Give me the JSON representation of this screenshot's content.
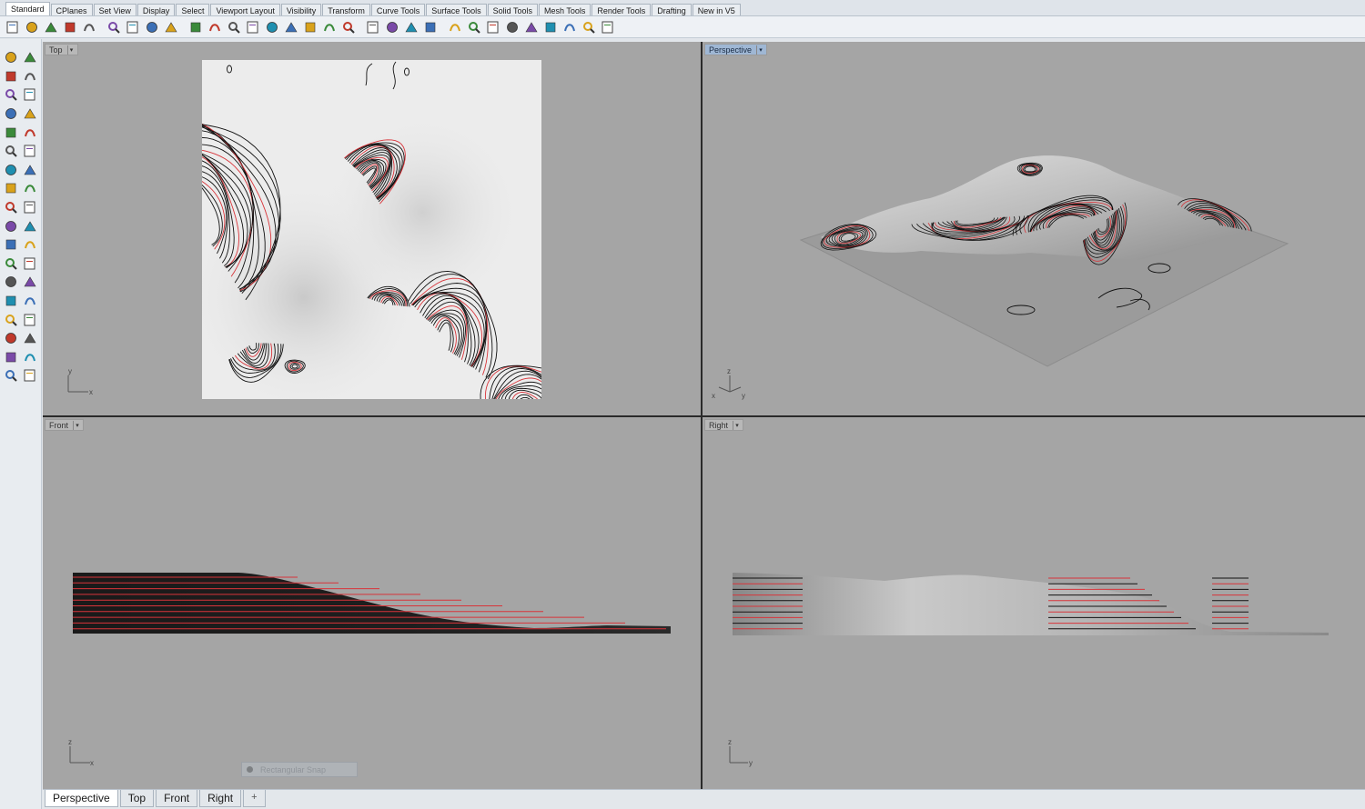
{
  "tabs": [
    {
      "label": "Standard",
      "active": true
    },
    {
      "label": "CPlanes"
    },
    {
      "label": "Set View"
    },
    {
      "label": "Display"
    },
    {
      "label": "Select"
    },
    {
      "label": "Viewport Layout"
    },
    {
      "label": "Visibility"
    },
    {
      "label": "Transform"
    },
    {
      "label": "Curve Tools"
    },
    {
      "label": "Surface Tools"
    },
    {
      "label": "Solid Tools"
    },
    {
      "label": "Mesh Tools"
    },
    {
      "label": "Render Tools"
    },
    {
      "label": "Drafting"
    },
    {
      "label": "New in V5"
    }
  ],
  "toolbar_icons": [
    "new-icon",
    "open-icon",
    "save-icon",
    "print-icon",
    "import-icon",
    "cut-icon",
    "copy-icon",
    "paste-icon",
    "undo-icon",
    "pan-icon",
    "move-view-icon",
    "zoom-icon",
    "zoom-window-icon",
    "zoom-extents-icon",
    "zoom-selected-icon",
    "rotate-view-icon",
    "four-viewports-icon",
    "car-icon",
    "hide-icon",
    "show-icon",
    "light-bulb-icon",
    "lock-icon",
    "shaded-icon",
    "rendered-icon",
    "material-icon",
    "ghosted-icon",
    "render-sphere-icon",
    "pointer-flag-icon",
    "layer-icon",
    "properties-icon",
    "help-icon"
  ],
  "palette_icons": [
    [
      "select-icon",
      "point-icon"
    ],
    [
      "polyline-icon",
      "curve-icon"
    ],
    [
      "circle-icon",
      "ellipse-icon"
    ],
    [
      "polygon-icon",
      "rectangle-icon"
    ],
    [
      "arc-icon",
      "fillet-icon"
    ],
    [
      "surface-icon",
      "loft-icon"
    ],
    [
      "box-icon",
      "sphere-icon"
    ],
    [
      "cylinder-icon",
      "plane-icon"
    ],
    [
      "trim-icon",
      "split-icon"
    ],
    [
      "boolean-icon",
      "explode-icon"
    ],
    [
      "mesh-icon",
      "points-icon"
    ],
    [
      "offset-icon",
      "extend-icon"
    ],
    [
      "text-icon",
      "dimension-icon"
    ],
    [
      "group-icon",
      "block-icon"
    ],
    [
      "solid-edit-icon",
      "measure-icon"
    ],
    [
      "array-icon",
      "align-icon"
    ],
    [
      "analyze-icon",
      "check-icon"
    ],
    [
      "render-icon",
      "light-icon"
    ]
  ],
  "viewports": {
    "top": {
      "title": "Top",
      "axis_h": "x",
      "axis_v": "y"
    },
    "perspective": {
      "title": "Perspective",
      "axis_a": "x",
      "axis_b": "y",
      "axis_v": "z"
    },
    "front": {
      "title": "Front",
      "axis_h": "x",
      "axis_v": "z"
    },
    "right": {
      "title": "Right",
      "axis_h": "y",
      "axis_v": "z"
    }
  },
  "snap_label": "Rectangular Snap",
  "bottom_tabs": [
    {
      "label": "Perspective",
      "active": true
    },
    {
      "label": "Top"
    },
    {
      "label": "Front"
    },
    {
      "label": "Right"
    }
  ],
  "bottom_add": "+",
  "colors": {
    "contour_red": "#d8343a",
    "contour_black": "#111111",
    "viewport_bg": "#a5a5a5",
    "active_title": "#9fb7d4"
  }
}
